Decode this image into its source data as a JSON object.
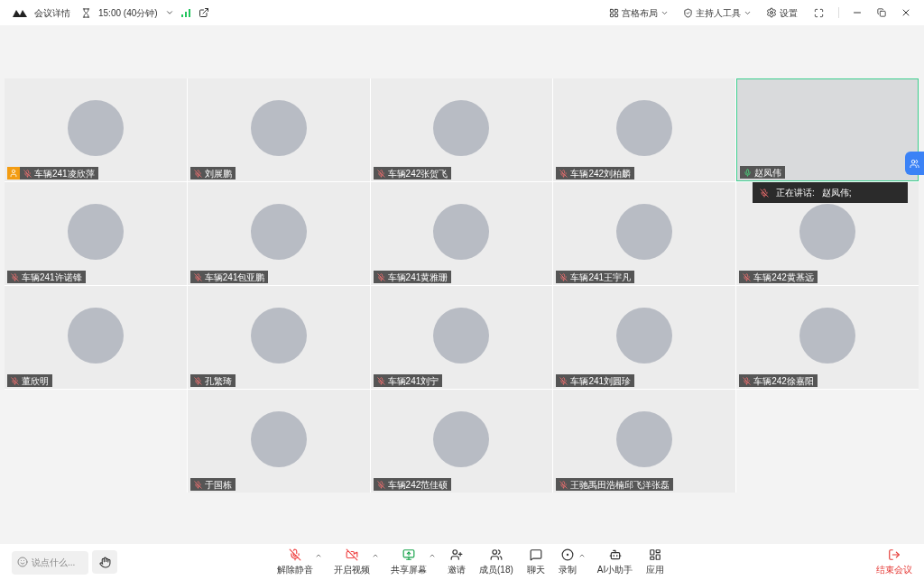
{
  "title_bar": {
    "meeting_info": "会议详情",
    "duration": "15:00 (40分钟)",
    "layout_button": "宫格布局",
    "host_tools_button": "主持人工具",
    "settings_button": "设置"
  },
  "participants": [
    {
      "kind": "avatar",
      "name": "车辆241凌欣萍",
      "host": true,
      "speaking": false
    },
    {
      "kind": "avatar",
      "name": "刘展鹏",
      "host": false,
      "speaking": false
    },
    {
      "kind": "avatar",
      "name": "车辆242张贺飞",
      "host": false,
      "speaking": false
    },
    {
      "kind": "avatar",
      "name": "车辆242刘柏麟",
      "host": false,
      "speaking": false
    },
    {
      "kind": "video",
      "name": "赵凤伟",
      "host": false,
      "speaking": true
    },
    {
      "kind": "avatar",
      "name": "车辆241许诺锋",
      "host": false,
      "speaking": false
    },
    {
      "kind": "avatar",
      "name": "车辆241包亚鹏",
      "host": false,
      "speaking": false
    },
    {
      "kind": "avatar",
      "name": "车辆241黄雅珊",
      "host": false,
      "speaking": false
    },
    {
      "kind": "avatar",
      "name": "车辆241王宇凡",
      "host": false,
      "speaking": false
    },
    {
      "kind": "avatar",
      "name": "车辆242黄基远",
      "host": false,
      "speaking": false
    },
    {
      "kind": "avatar",
      "name": "董欣明",
      "host": false,
      "speaking": false
    },
    {
      "kind": "avatar",
      "name": "孔繁琦",
      "host": false,
      "speaking": false
    },
    {
      "kind": "avatar",
      "name": "车辆241刘宁",
      "host": false,
      "speaking": false
    },
    {
      "kind": "avatar",
      "name": "车辆241刘圓珍",
      "host": false,
      "speaking": false
    },
    {
      "kind": "avatar",
      "name": "车辆242徐嘉阳",
      "host": false,
      "speaking": false
    },
    {
      "kind": "empty"
    },
    {
      "kind": "avatar",
      "name": "于国栋",
      "host": false,
      "speaking": false
    },
    {
      "kind": "avatar",
      "name": "车辆242范佳硕",
      "host": false,
      "speaking": false
    },
    {
      "kind": "avatar",
      "name": "王驰禹田浩楠邱飞洋张磊",
      "host": false,
      "speaking": false
    },
    {
      "kind": "empty"
    }
  ],
  "speaking_popup": {
    "label": "正在讲话:",
    "speaker": "赵凤伟;"
  },
  "chat_input": {
    "placeholder": "说点什么..."
  },
  "toolbar": [
    {
      "kind": "mic",
      "label": "解除静音",
      "off": true,
      "menu": true
    },
    {
      "kind": "video",
      "label": "开启视频",
      "off": true,
      "menu": true
    },
    {
      "kind": "share",
      "label": "共享屏幕",
      "off": false,
      "menu": true
    },
    {
      "kind": "invite",
      "label": "邀请",
      "off": false,
      "menu": false
    },
    {
      "kind": "members",
      "label": "成员(18)",
      "off": false,
      "menu": false
    },
    {
      "kind": "chat",
      "label": "聊天",
      "off": false,
      "menu": false
    },
    {
      "kind": "record",
      "label": "录制",
      "off": false,
      "menu": true
    },
    {
      "kind": "ai",
      "label": "AI小助手",
      "off": false,
      "menu": false
    },
    {
      "kind": "apps",
      "label": "应用",
      "off": false,
      "menu": false
    }
  ],
  "end_button": "结束会议"
}
